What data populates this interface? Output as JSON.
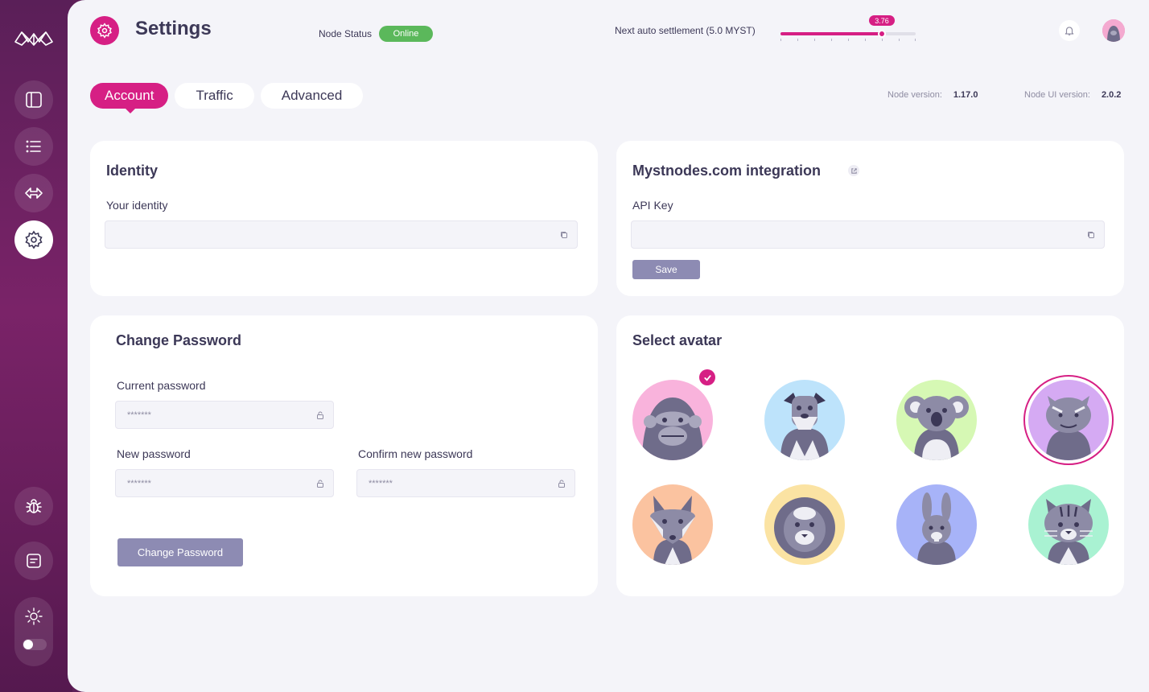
{
  "header": {
    "title": "Settings",
    "node_status_label": "Node Status",
    "node_status_value": "Online",
    "settlement_label": "Next auto settlement (5.0 MYST)",
    "settlement_value": "3.76",
    "settlement_fraction": 0.752
  },
  "tabs": [
    {
      "label": "Account",
      "active": true
    },
    {
      "label": "Traffic",
      "active": false
    },
    {
      "label": "Advanced",
      "active": false
    }
  ],
  "versions": {
    "node_label": "Node version:",
    "node_value": "1.17.0",
    "ui_label": "Node UI version:",
    "ui_value": "2.0.2"
  },
  "identity": {
    "title": "Identity",
    "field_label": "Your identity",
    "value": ""
  },
  "mystnodes": {
    "title": "Mystnodes.com integration",
    "api_label": "API Key",
    "api_value": "",
    "save_label": "Save"
  },
  "password": {
    "title": "Change Password",
    "current_label": "Current password",
    "current_value": "*******",
    "new_label": "New password",
    "new_value": "*******",
    "confirm_label": "Confirm new password",
    "confirm_value": "*******",
    "button_label": "Change Password"
  },
  "avatars": {
    "title": "Select avatar",
    "items": [
      {
        "name": "gorilla",
        "bg": "#f9b3dc",
        "checked": true
      },
      {
        "name": "schnauzer",
        "bg": "#bde3fb"
      },
      {
        "name": "koala",
        "bg": "#d6f8b4"
      },
      {
        "name": "cat",
        "bg": "#d5aaf3",
        "selected": true
      },
      {
        "name": "fox",
        "bg": "#fbc3a0"
      },
      {
        "name": "lion",
        "bg": "#fbe3a3"
      },
      {
        "name": "rabbit",
        "bg": "#a7b3f8"
      },
      {
        "name": "tabby-cat",
        "bg": "#a9f2d2"
      }
    ]
  },
  "colors": {
    "accent": "#d61f84",
    "status_online": "#5bb85b",
    "button": "#8d8bb3",
    "sidebar": "#7a2368"
  }
}
